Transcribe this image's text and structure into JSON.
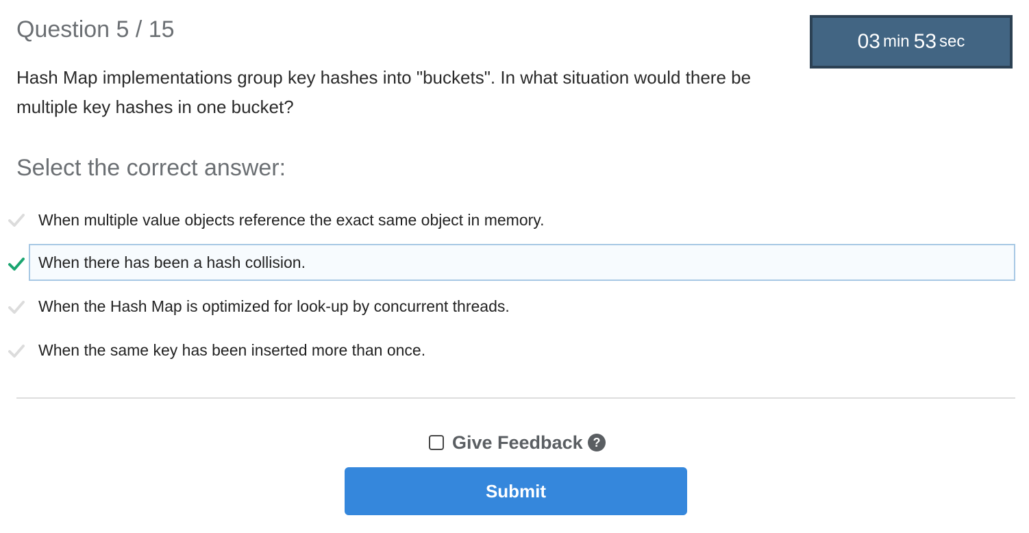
{
  "header": {
    "question_counter": "Question 5 / 15"
  },
  "timer": {
    "minutes": "03",
    "minutes_unit": "min",
    "seconds": "53",
    "seconds_unit": "sec"
  },
  "question": {
    "text": "Hash Map implementations group key hashes into \"buckets\". In what situation would there be multiple key hashes in one bucket?"
  },
  "answers": {
    "heading": "Select the correct answer:",
    "selected_index": 1,
    "options": [
      {
        "label": "When multiple value objects reference the exact same object in memory.",
        "checked": false
      },
      {
        "label": "When there has been a hash collision.",
        "checked": true
      },
      {
        "label": "When the Hash Map is optimized for look-up by concurrent threads.",
        "checked": false
      },
      {
        "label": "When the same key has been inserted more than once.",
        "checked": false
      }
    ]
  },
  "feedback": {
    "label": "Give Feedback",
    "checked": false,
    "icon": "question-circle-icon"
  },
  "submit": {
    "label": "Submit"
  },
  "colors": {
    "timer_bg": "#426583",
    "check_active": "#1aa570",
    "check_inactive": "#dcdcdc",
    "selected_border": "#a7c8e4",
    "submit_bg": "#3587dc"
  }
}
